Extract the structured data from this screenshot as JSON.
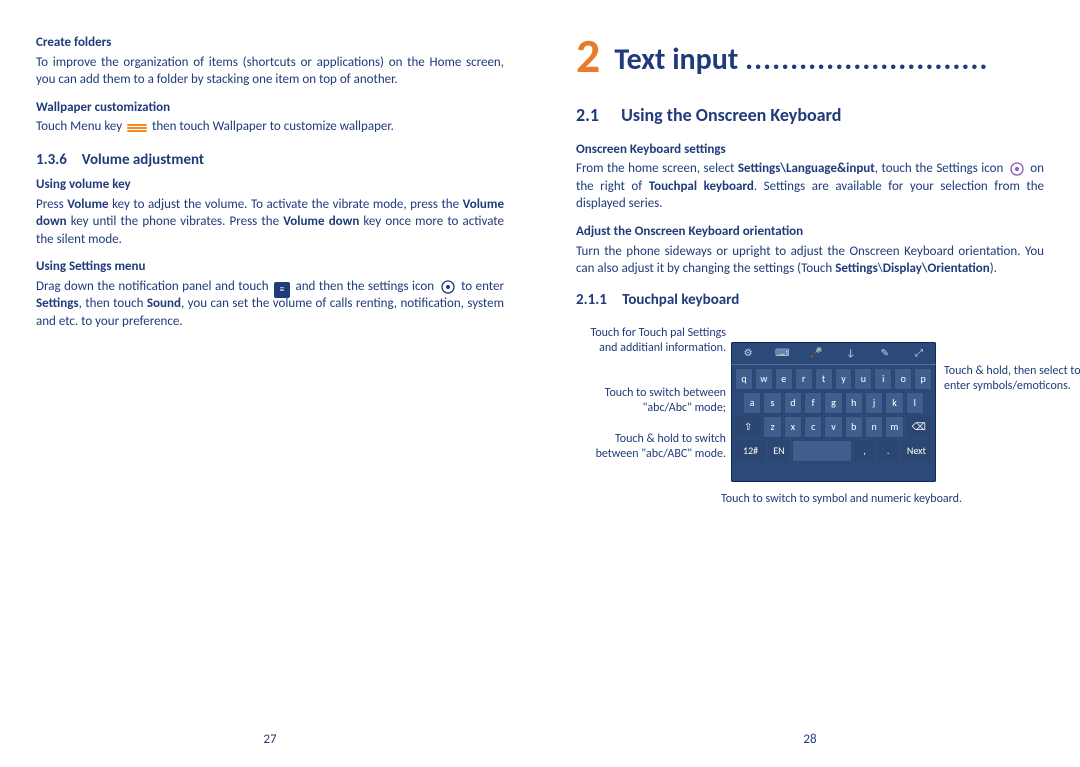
{
  "left": {
    "h_create_folders": "Create folders",
    "p_create_folders": "To improve the organization of items (shortcuts or applications) on the Home screen, you can add them to a folder by stacking one item on top of another.",
    "h_wallpaper": "Wallpaper customization",
    "p_wallpaper_1": "Touch Menu key ",
    "p_wallpaper_2": " then touch Wallpaper to customize wallpaper.",
    "sec_num": "1.3.6",
    "sec_title": "Volume adjustment",
    "h_vol_key": "Using volume key",
    "p_vol_key_1": "Press ",
    "p_vol_key_b1": "Volume",
    "p_vol_key_2": " key to adjust the volume. To activate the vibrate mode, press the ",
    "p_vol_key_b2": "Volume down",
    "p_vol_key_3": " key until the phone vibrates. Press the ",
    "p_vol_key_b3": "Volume down",
    "p_vol_key_4": " key once more to activate the silent mode.",
    "h_settings_menu": "Using Settings menu",
    "p_settings_1": "Drag down the notification panel and touch ",
    "p_settings_2": " and then the settings icon ",
    "p_settings_3": " to enter ",
    "p_settings_b1": "Settings",
    "p_settings_4": ", then touch ",
    "p_settings_b2": "Sound",
    "p_settings_5": ", you can set the volume of calls renting, notification, system and etc. to your preference.",
    "page_num": "27"
  },
  "right": {
    "ch_num": "2",
    "ch_title": "Text input",
    "ch_dots": "...........................",
    "h2_num": "2.1",
    "h2_title": "Using the Onscreen Keyboard",
    "h_osk_settings": "Onscreen Keyboard settings",
    "p_osk_1": "From the home screen, select ",
    "p_osk_b1": "Settings\\Language&input",
    "p_osk_2": ", touch the Settings icon ",
    "p_osk_3": " on the right of ",
    "p_osk_b2": "Touchpal keyboard",
    "p_osk_4": ". Settings are available for your selection from the displayed series.",
    "h_orientation": "Adjust the Onscreen Keyboard orientation",
    "p_orient_1": "Turn the phone sideways or upright to adjust the Onscreen Keyboard orientation. You can also adjust it by changing the settings (Touch ",
    "p_orient_b1": "Settings",
    "p_orient_2": "\\",
    "p_orient_b2": "Display\\Orientation",
    "p_orient_3": ").",
    "sub_num": "2.1.1",
    "sub_title": "Touchpal keyboard",
    "callout1": "Touch for Touch pal Settings and additianl information.",
    "callout2": "Touch to switch between \"abc/Abc\" mode;",
    "callout3": "Touch & hold to switch between \"abc/ABC\" mode.",
    "callout_right": "Touch & hold, then select to enter symbols/emoticons.",
    "callout_bottom": "Touch to switch to symbol and numeric keyboard.",
    "kb_row1": [
      "q",
      "w",
      "e",
      "r",
      "t",
      "y",
      "u",
      "i",
      "o",
      "p"
    ],
    "kb_row2": [
      "a",
      "s",
      "d",
      "f",
      "g",
      "h",
      "j",
      "k",
      "l"
    ],
    "kb_row3": [
      "⇧",
      "z",
      "x",
      "c",
      "v",
      "b",
      "n",
      "m",
      "⌫"
    ],
    "kb_row4": [
      "12#",
      "EN",
      ",",
      ".",
      "Next"
    ],
    "page_num": "28"
  }
}
